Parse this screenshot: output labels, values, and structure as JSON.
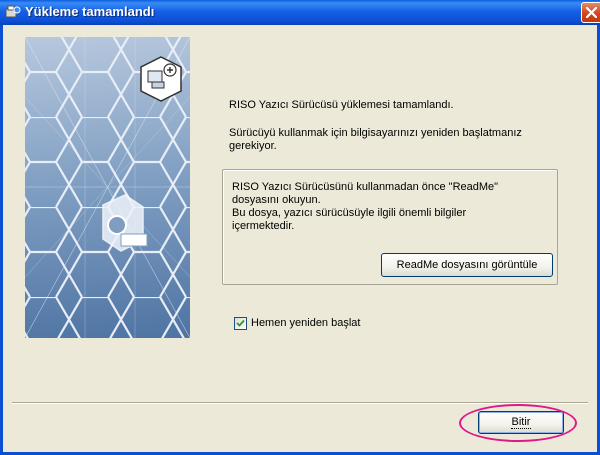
{
  "window": {
    "title": "Yükleme tamamlandı",
    "accent_color": "#0b4fd4",
    "close_icon": "close-icon"
  },
  "content": {
    "message1": "RISO Yazıcı Sürücüsü yüklemesi tamamlandı.",
    "message2_line1": "Sürücüyü kullanmak için bilgisayarınızı yeniden başlatmanız",
    "message2_line2": "gerekiyor."
  },
  "readme_group": {
    "line1": "RISO Yazıcı Sürücüsünü kullanmadan önce \"ReadMe\"",
    "line2": "dosyasını okuyun.",
    "line3": "Bu dosya, yazıcı sürücüsüyle ilgili önemli bilgiler",
    "line4": "içermektedir.",
    "button_label": "ReadMe dosyasını görüntüle"
  },
  "restart": {
    "checked": true,
    "label": "Hemen yeniden başlat"
  },
  "footer": {
    "finish_label": "Bitir",
    "highlight_color": "#e0188c"
  }
}
